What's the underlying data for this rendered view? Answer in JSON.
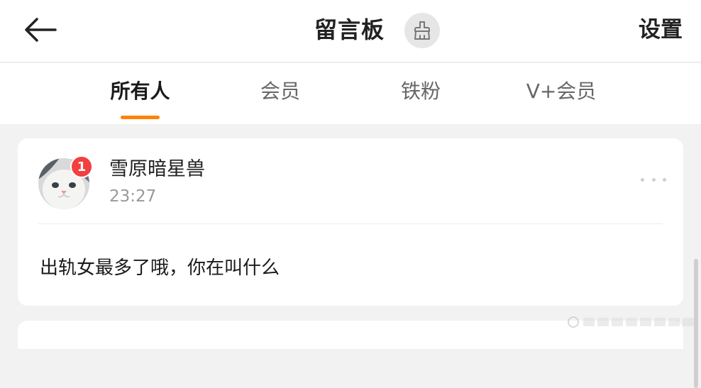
{
  "header": {
    "title": "留言板",
    "settings_label": "设置",
    "icons": {
      "back": "arrow-left-icon",
      "clean": "broom-icon"
    }
  },
  "tabs": [
    {
      "label": "所有人",
      "active": true
    },
    {
      "label": "会员",
      "active": false
    },
    {
      "label": "铁粉",
      "active": false
    },
    {
      "label": "V+会员",
      "active": false
    }
  ],
  "colors": {
    "accent": "#ff8200",
    "badge": "#f23f3f",
    "background": "#f2f2f2"
  },
  "messages": [
    {
      "username": "雪原暗星兽",
      "time": "23:27",
      "badge_count": "1",
      "content": "出轨女最多了哦，你在叫什么",
      "avatar_icon": "cat-avatar-icon",
      "more_icon": "more-dots-icon"
    }
  ]
}
